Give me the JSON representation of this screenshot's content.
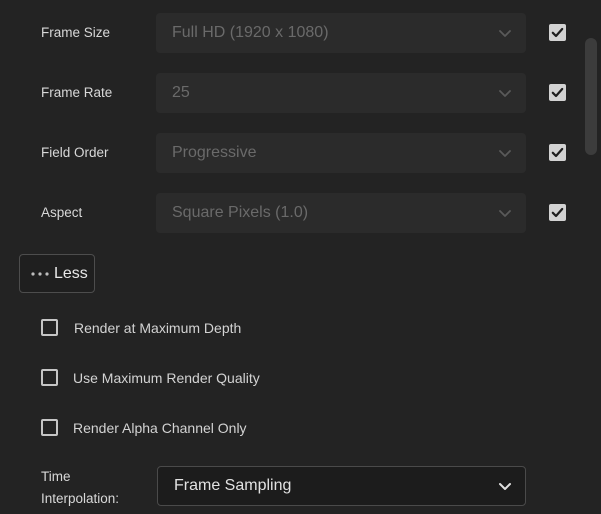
{
  "rows": [
    {
      "label": "Frame Size",
      "value": "Full HD (1920 x 1080)",
      "override_checked": true
    },
    {
      "label": "Frame Rate",
      "value": "25",
      "override_checked": true
    },
    {
      "label": "Field Order",
      "value": "Progressive",
      "override_checked": true
    },
    {
      "label": "Aspect",
      "value": "Square Pixels (1.0)",
      "override_checked": true
    }
  ],
  "less_button": {
    "label": "Less"
  },
  "options": [
    {
      "label": "Render at Maximum Depth",
      "checked": false
    },
    {
      "label": "Use Maximum Render Quality",
      "checked": false
    },
    {
      "label": "Render Alpha Channel Only",
      "checked": false
    }
  ],
  "time_interpolation": {
    "label_line1": "Time",
    "label_line2": "Interpolation:",
    "value": "Frame Sampling"
  },
  "icons": {
    "chevron": "chevron-down-icon",
    "check": "checkmark-icon",
    "more": "ellipsis-icon"
  },
  "colors": {
    "background": "#232323",
    "disabled_select": "#2b2b2b",
    "enabled_select": "#1c1c1c",
    "checkbox_fill": "#d2d2d2"
  }
}
